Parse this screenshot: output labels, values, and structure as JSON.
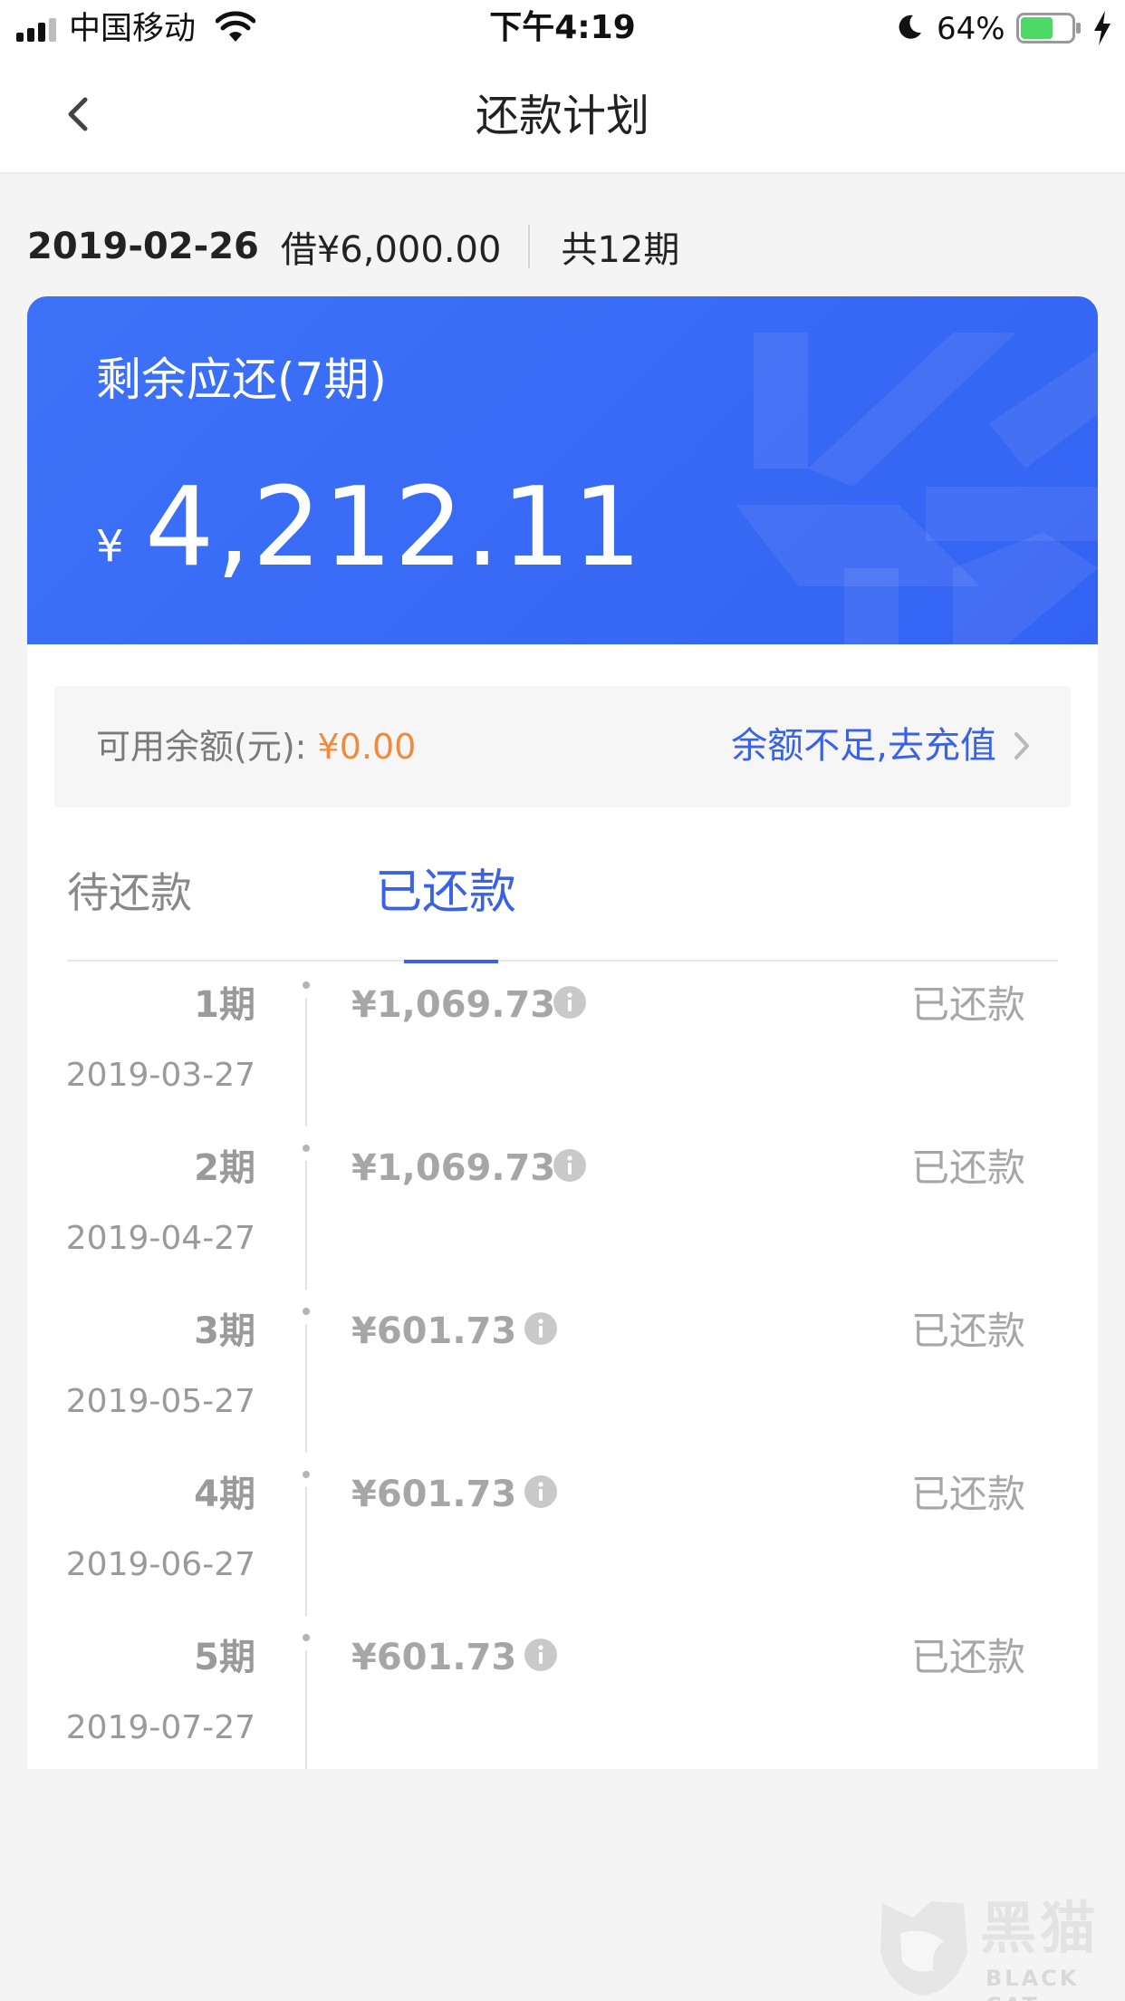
{
  "status_bar": {
    "carrier": "中国移动",
    "time": "下午4:19",
    "battery": "64%",
    "battery_level": 0.64,
    "battery_color": "#4cd964"
  },
  "nav": {
    "title": "还款计划",
    "back_icon": "chevron-left-icon"
  },
  "loan": {
    "date": "2019-02-26",
    "amount": "借¥6,000.00",
    "total_periods": "共12期"
  },
  "summary": {
    "label": "剩余应还(7期)",
    "currency": "¥",
    "amount": "4,212.11",
    "header_color": "#3463f3"
  },
  "balance": {
    "label": "可用余额(元): ",
    "value": "¥0.00",
    "recharge": "余额不足,去充值"
  },
  "tabs": [
    {
      "label": "待还款",
      "active": false
    },
    {
      "label": "已还款",
      "active": true
    }
  ],
  "periods": [
    {
      "no": "1期",
      "date": "2019-03-27",
      "amount": "¥1,069.73",
      "status": "已还款"
    },
    {
      "no": "2期",
      "date": "2019-04-27",
      "amount": "¥1,069.73",
      "status": "已还款"
    },
    {
      "no": "3期",
      "date": "2019-05-27",
      "amount": "¥601.73",
      "status": "已还款"
    },
    {
      "no": "4期",
      "date": "2019-06-27",
      "amount": "¥601.73",
      "status": "已还款"
    },
    {
      "no": "5期",
      "date": "2019-07-27",
      "amount": "¥601.73",
      "status": "已还款"
    }
  ],
  "watermark": {
    "text": "黑猫",
    "sub": "BLACK CAT"
  }
}
